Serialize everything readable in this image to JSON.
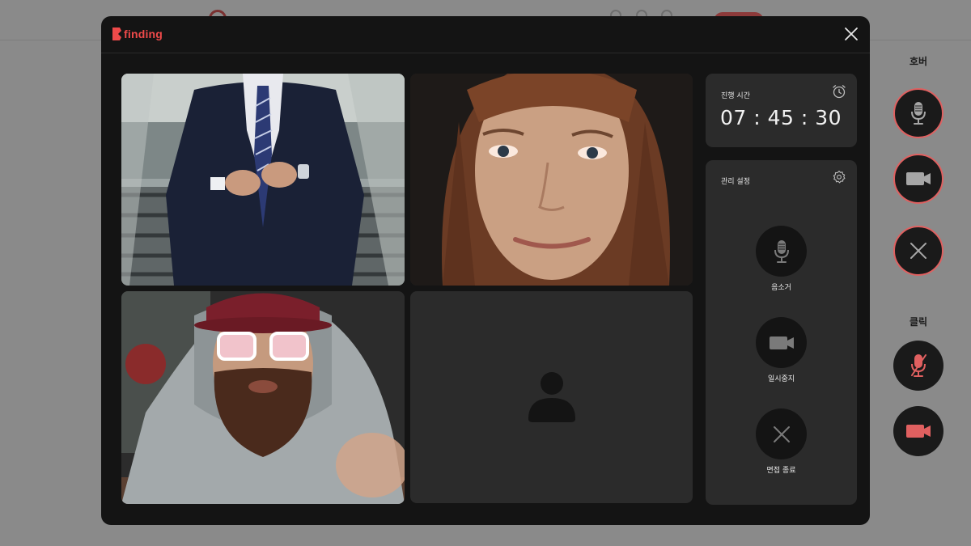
{
  "brand": {
    "name": "finding",
    "color": "#ef4a4a"
  },
  "timer": {
    "label": "진행 시간",
    "value": "07 : 45 : 30",
    "icon": "alarm-clock-icon"
  },
  "controls": {
    "label": "관리 설정",
    "settings_icon": "gear-icon",
    "items": [
      {
        "label": "음소거",
        "icon": "microphone-icon"
      },
      {
        "label": "일시중지",
        "icon": "video-camera-icon"
      },
      {
        "label": "면접 종료",
        "icon": "close-icon"
      }
    ]
  },
  "participants": [
    {
      "name": "participant-suit",
      "has_video": true
    },
    {
      "name": "participant-woman",
      "has_video": true
    },
    {
      "name": "participant-hoodie",
      "has_video": true
    },
    {
      "name": "participant-empty",
      "has_video": false,
      "placeholder_icon": "user-silhouette-icon"
    }
  ],
  "legend": {
    "hover_title": "호버",
    "click_title": "클릭",
    "accent": "#e06060"
  }
}
